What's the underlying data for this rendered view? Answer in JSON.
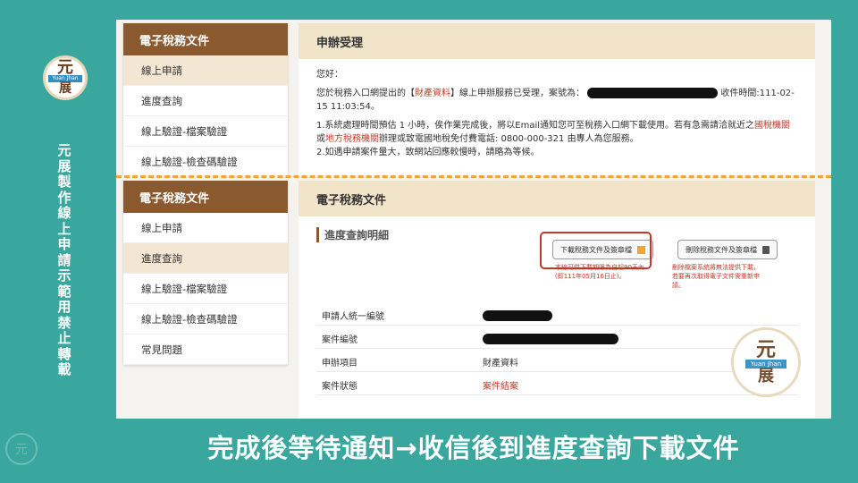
{
  "logo": {
    "top_char": "元",
    "ribbon": "Yuan Jhan",
    "bottom_char": "展"
  },
  "side_text": "元展製作線上申請示範用 禁止轉載",
  "top": {
    "menu_title": "電子稅務文件",
    "menu_items": [
      "線上申請",
      "進度查詢",
      "線上驗證-檔案驗證",
      "線上驗證-檢查碼驗證"
    ],
    "content_title": "申辦受理",
    "greeting": "您好：",
    "para1_a": "您於稅務入口網提出的【",
    "para1_highlight": "財產資料",
    "para1_b": "】線上申辦服務已受理，案號為：",
    "para1_c": "收件時間:111-02-15 11:03:54。",
    "para2_a": "1.系統處理時間預估 1 小時，俟作業完成後，將以Email通知您可至稅務入口網下載使用。若有急需請洽就近之",
    "para2_link1": "國稅機關",
    "para2_b": "或",
    "para2_link2": "地方稅務機關",
    "para2_c": "辦理或致電國地稅免付費電話: 0800-000-321 由專人為您服務。",
    "para3": "2.如遇申請案件量大，致網站回應較慢時，請略為等候。"
  },
  "bottom": {
    "menu_title": "電子稅務文件",
    "menu_items": [
      "線上申請",
      "進度查詢",
      "線上驗證-檔案驗證",
      "線上驗證-檢查碼驗證",
      "常見問題"
    ],
    "content_title": "電子稅務文件",
    "section_title": "進度查詢明細",
    "download_btn": "下載稅務文件及簽章檔",
    "delete_btn": "刪除稅務文件及簽章檔",
    "download_note": "本線可供下載期限為自起90天內 (即111年05月16日止)。",
    "delete_note": "刪除檔案系統將無法提供下載，若要再次取得電子文件需重新申請。",
    "rows": [
      {
        "label": "申請人統一編號",
        "value": ""
      },
      {
        "label": "案件編號",
        "value": ""
      },
      {
        "label": "申辦項目",
        "value": "財產資料"
      },
      {
        "label": "案件狀態",
        "value": "案件結案"
      }
    ]
  },
  "caption": "完成後等待通知→收信後到進度查詢下載文件",
  "colors": {
    "teal": "#3aa79e",
    "brown": "#8a5a2e",
    "highlight": "#c0392b",
    "dash": "#f2a437"
  }
}
